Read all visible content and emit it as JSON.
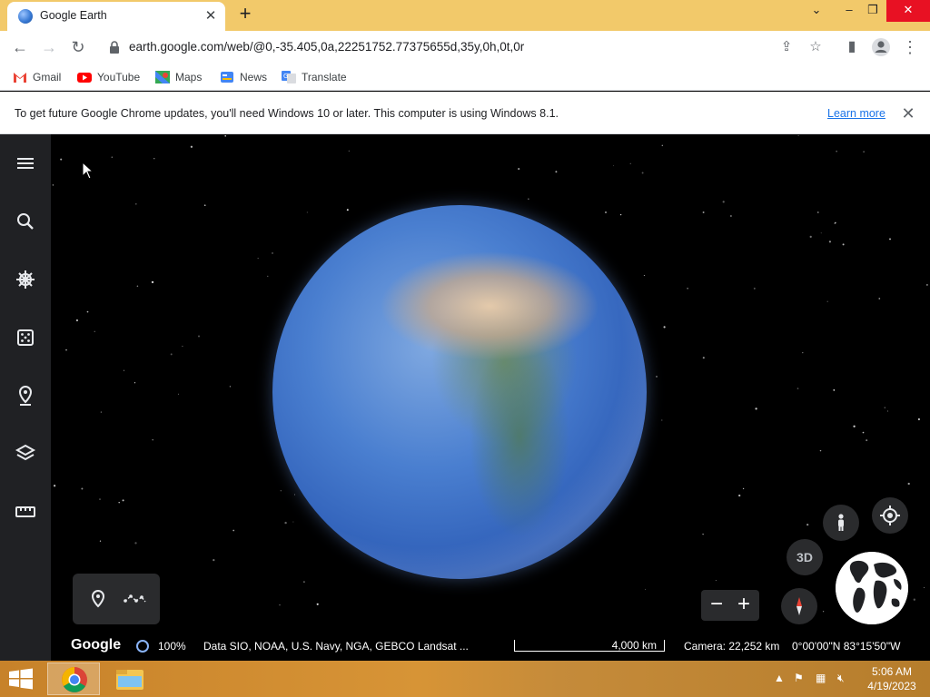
{
  "browser": {
    "tab_title": "Google Earth",
    "url": "earth.google.com/web/@0,-35.405,0a,22251752.77375655d,35y,0h,0t,0r"
  },
  "bookmarks": [
    {
      "label": "Gmail",
      "icon": "gmail-icon"
    },
    {
      "label": "YouTube",
      "icon": "youtube-icon"
    },
    {
      "label": "Maps",
      "icon": "maps-icon"
    },
    {
      "label": "News",
      "icon": "news-icon"
    },
    {
      "label": "Translate",
      "icon": "translate-icon"
    }
  ],
  "infobar": {
    "message": "To get future Google Chrome updates, you'll need Windows 10 or later. This computer is using Windows 8.1.",
    "link": "Learn more"
  },
  "earth": {
    "sidebar_items": [
      "menu-icon",
      "search-icon",
      "voyager-icon",
      "feeling-lucky-icon",
      "projects-icon",
      "map-style-icon",
      "measure-icon"
    ],
    "view_3d_label": "3D",
    "status": {
      "logo": "Google",
      "load_percent": "100%",
      "data_credits": "Data SIO, NOAA, U.S. Navy, NGA, GEBCO  Landsat ...",
      "scale": "4,000 km",
      "camera": "Camera: 22,252 km",
      "coordinates": "0°00'00\"N 83°15'50\"W"
    }
  },
  "taskbar": {
    "time": "5:06 AM",
    "date": "4/19/2023"
  },
  "colors": {
    "tabstrip": "#f2c96a",
    "sidebar": "#202124",
    "close_button": "#e81123",
    "link": "#1a73e8"
  }
}
